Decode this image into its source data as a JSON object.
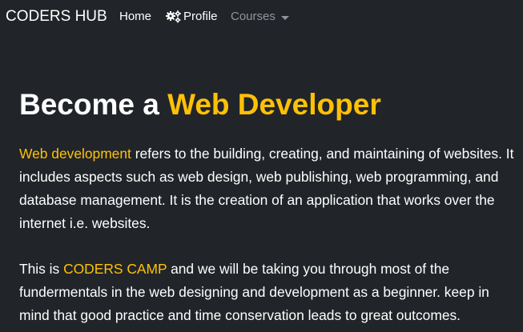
{
  "navbar": {
    "brand": "CODERS HUB",
    "items": [
      {
        "label": "Home"
      },
      {
        "label": "Profile",
        "icon": "gears-icon"
      },
      {
        "label": "Courses",
        "icon": "caret-down-icon"
      }
    ]
  },
  "hero": {
    "title_prefix": "Become a ",
    "title_highlight": "Web Developer"
  },
  "paragraphs": {
    "p1_highlight": "Web development",
    "p1_text": " refers to the building, creating, and maintaining of websites. It includes aspects such as web design, web publishing, web programming, and database management. It is the creation of an application that works over the internet i.e. websites.",
    "p2_prefix": "This is ",
    "p2_highlight": "CODERS CAMP",
    "p2_text": " and we will be taking you through most of the fundermentals in the web designing and development as a beginner. keep in mind that good practice and time conservation leads to great outcomes."
  },
  "colors": {
    "background": "#212529",
    "accent": "#ffc107",
    "text": "#ffffff",
    "muted_nav": "#8f959a"
  }
}
